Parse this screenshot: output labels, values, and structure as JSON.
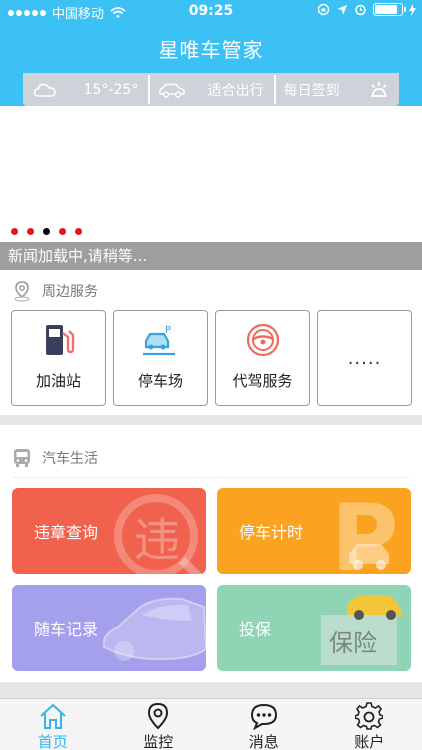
{
  "status": {
    "carrier": "中国移动",
    "time": "09:25",
    "battery_level": 0.85
  },
  "header": {
    "title": "星唯车管家"
  },
  "weather_bar": {
    "temperature": "15°-25°",
    "temperature_icon": "cloud-icon",
    "travel_hint": "适合出行",
    "travel_icon": "car-outline-icon",
    "checkin": "每日签到",
    "checkin_icon": "sun-icon"
  },
  "banner": {
    "pager_count": 5,
    "active_index": 2
  },
  "news": {
    "text": "新闻加载中,请稍等..."
  },
  "nearby": {
    "title": "周边服务",
    "items": [
      {
        "label": "加油站",
        "icon": "fuel-pump-icon"
      },
      {
        "label": "停车场",
        "icon": "parking-car-icon"
      },
      {
        "label": "代驾服务",
        "icon": "steering-wheel-icon"
      },
      {
        "label": "....."
      }
    ]
  },
  "car_life": {
    "title": "汽车生活",
    "cards": [
      {
        "label": "违章查询",
        "color": "#f0624e",
        "art_text": "违"
      },
      {
        "label": "停车计时",
        "color": "#fba320",
        "art_text": "P"
      },
      {
        "label": "随车记录",
        "color": "#a4a0ec"
      },
      {
        "label": "投保",
        "color": "#8fd4b4",
        "art_text": "保险"
      }
    ]
  },
  "tabs": [
    {
      "label": "首页",
      "icon": "home-icon",
      "active": true
    },
    {
      "label": "监控",
      "icon": "location-pin-icon",
      "active": false
    },
    {
      "label": "消息",
      "icon": "chat-bubble-icon",
      "active": false
    },
    {
      "label": "账户",
      "icon": "gear-icon",
      "active": false
    }
  ],
  "colors": {
    "brand": "#3bc1f3",
    "pager_dot": "#e8141d",
    "tab_active": "#3bb3e8"
  }
}
